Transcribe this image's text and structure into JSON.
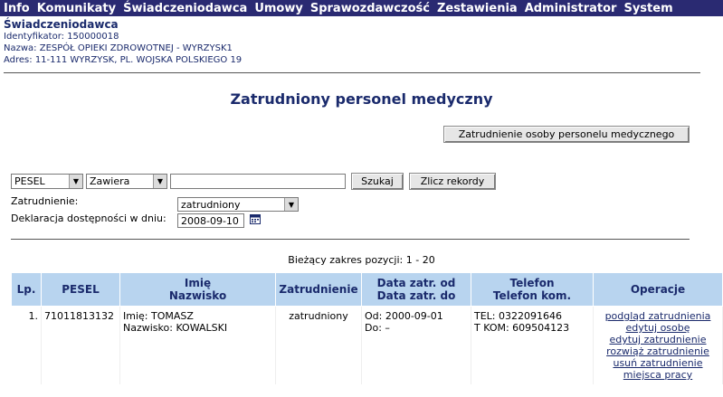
{
  "menu": [
    "Info",
    "Komunikaty",
    "Świadczeniodawca",
    "Umowy",
    "Sprawozdawczość",
    "Zestawienia",
    "Administrator",
    "System"
  ],
  "provider": {
    "title": "Świadczeniodawca",
    "id_line": "Identyfikator: 150000018",
    "name_line": "Nazwa: ZESPÓŁ OPIEKI ZDROWOTNEJ - WYRZYSK1",
    "address_line": "Adres: 11-111 WYRZYSK, PL. WOJSKA POLSKIEGO 19"
  },
  "page_title": "Zatrudniony personel medyczny",
  "employ_button": "Zatrudnienie osoby personelu medycznego",
  "search": {
    "field_select": "PESEL",
    "op_select": "Zawiera",
    "query": "",
    "search_button": "Szukaj",
    "count_button": "Zlicz rekordy"
  },
  "filter": {
    "employment_label": "Zatrudnienie:",
    "employment_value": "zatrudniony",
    "declaration_label": "Deklaracja dostępności w dniu:",
    "declaration_date": "2008-09-10"
  },
  "range_text": "Bieżący zakres pozycji: 1 - 20",
  "table": {
    "headers": {
      "lp": "Lp.",
      "pesel": "PESEL",
      "name1": "Imię",
      "name2": "Nazwisko",
      "employment": "Zatrudnienie",
      "date1": "Data zatr. od",
      "date2": "Data zatr. do",
      "phone1": "Telefon",
      "phone2": "Telefon kom.",
      "ops": "Operacje"
    },
    "rows": [
      {
        "lp": "1.",
        "pesel": "71011813132",
        "first": "Imię: TOMASZ",
        "last": "Nazwisko: KOWALSKI",
        "employment": "zatrudniony",
        "from": "Od: 2000-09-01",
        "to": "Do: –",
        "phone": "TEL: 0322091646",
        "mobile": "T KOM: 609504123",
        "ops": [
          "podgląd zatrudnienia",
          "edytuj osobę",
          "edytuj zatrudnienie",
          "rozwiąż zatrudnienie",
          "usuń zatrudnienie",
          "miejsca pracy"
        ]
      }
    ]
  }
}
